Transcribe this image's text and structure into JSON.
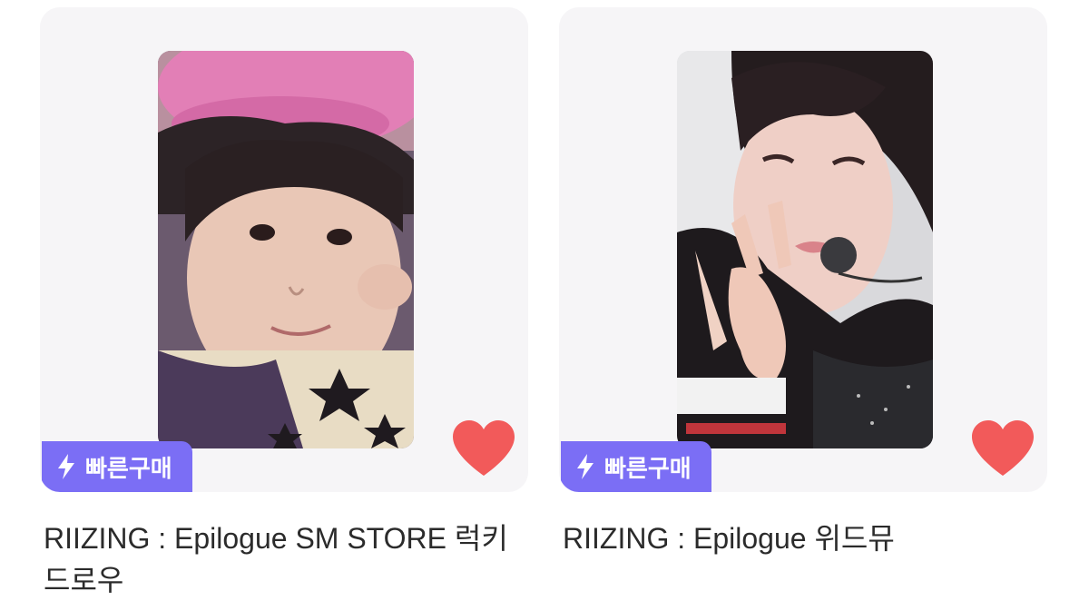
{
  "products": [
    {
      "badge": "빠른구매",
      "title": "RIIZING : Epilogue SM STORE 럭키드로우",
      "badge_color": "#7b6ef5",
      "heart_color": "#f25a5a",
      "icons": {
        "badge": "lightning-icon",
        "like": "heart-icon"
      }
    },
    {
      "badge": "빠른구매",
      "title": "RIIZING : Epilogue 위드뮤",
      "badge_color": "#7b6ef5",
      "heart_color": "#f25a5a",
      "icons": {
        "badge": "lightning-icon",
        "like": "heart-icon"
      }
    }
  ]
}
